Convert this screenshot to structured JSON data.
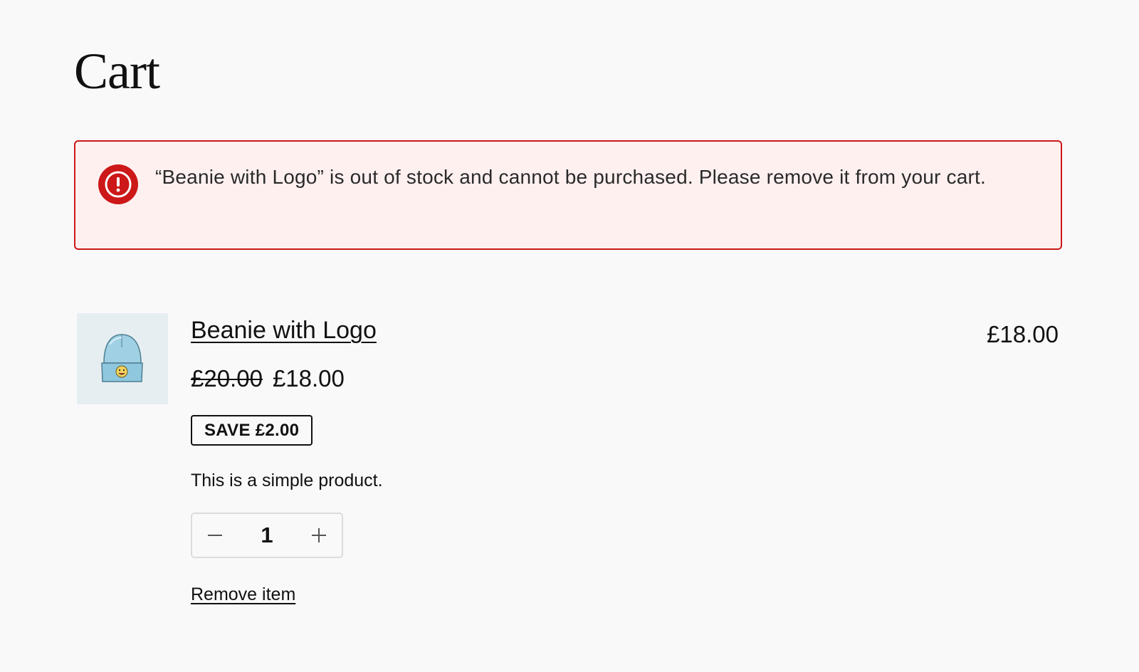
{
  "page": {
    "title": "Cart"
  },
  "notice": {
    "type": "error",
    "icon": "error-icon",
    "message": "“Beanie with Logo” is out of stock and cannot be purchased. Please remove it from your cart.",
    "border_color": "#cc1818",
    "background_color": "#fff0f0"
  },
  "cart_item": {
    "image_icon": "beanie-product-image",
    "name": "Beanie with Logo",
    "regular_price": "£20.00",
    "sale_price": "£18.00",
    "save_badge": "SAVE £2.00",
    "description": "This is a simple product.",
    "quantity": "1",
    "quantity_minus_icon": "minus-icon",
    "quantity_plus_icon": "plus-icon",
    "remove_label": "Remove item",
    "line_total": "£18.00"
  }
}
